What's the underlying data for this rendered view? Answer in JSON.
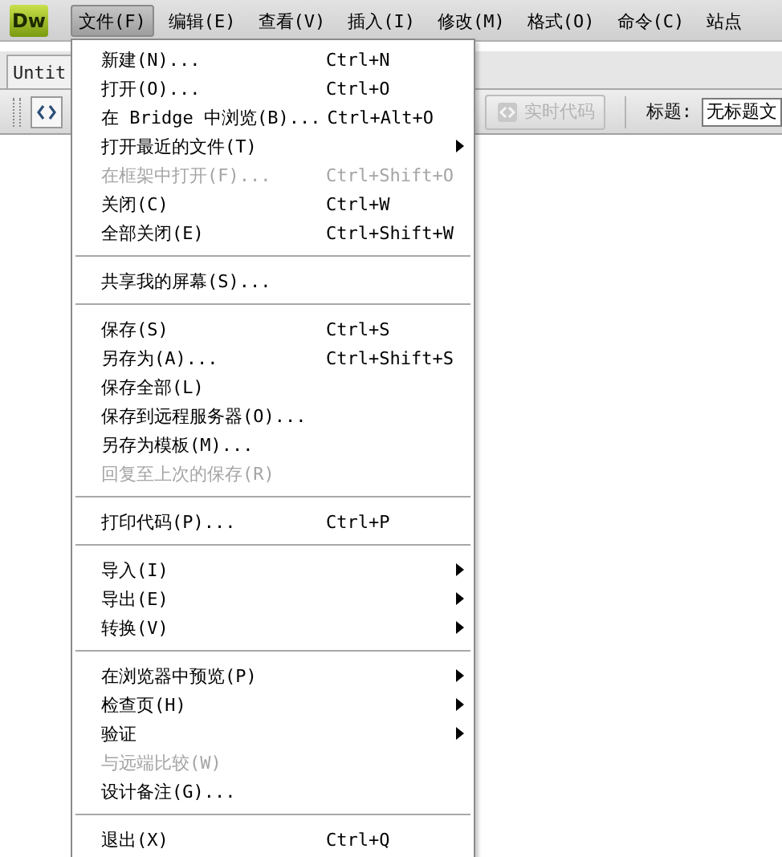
{
  "app": {
    "logo": "Dw"
  },
  "menubar": [
    {
      "label": "文件(F)",
      "selected": true
    },
    {
      "label": "编辑(E)",
      "selected": false
    },
    {
      "label": "查看(V)",
      "selected": false
    },
    {
      "label": "插入(I)",
      "selected": false
    },
    {
      "label": "修改(M)",
      "selected": false
    },
    {
      "label": "格式(O)",
      "selected": false
    },
    {
      "label": "命令(C)",
      "selected": false
    },
    {
      "label": "站点",
      "selected": false
    }
  ],
  "document_tab": {
    "label": "Untit"
  },
  "toolbar": {
    "live_code_button": {
      "label": "实时代码",
      "disabled": true
    },
    "title_label": "标题:",
    "title_field": {
      "value": "无标题文"
    }
  },
  "menu": [
    {
      "kind": "item",
      "label": "新建(N)...",
      "shortcut": "Ctrl+N",
      "disabled": false,
      "submenu": false
    },
    {
      "kind": "item",
      "label": "打开(O)...",
      "shortcut": "Ctrl+O",
      "disabled": false,
      "submenu": false
    },
    {
      "kind": "item",
      "label": "在 Bridge 中浏览(B)...",
      "shortcut": "Ctrl+Alt+O",
      "disabled": false,
      "submenu": false
    },
    {
      "kind": "item",
      "label": "打开最近的文件(T)",
      "disabled": false,
      "submenu": true
    },
    {
      "kind": "item",
      "label": "在框架中打开(F)...",
      "shortcut": "Ctrl+Shift+O",
      "disabled": true,
      "submenu": false
    },
    {
      "kind": "item",
      "label": "关闭(C)",
      "shortcut": "Ctrl+W",
      "disabled": false,
      "submenu": false
    },
    {
      "kind": "item",
      "label": "全部关闭(E)",
      "shortcut": "Ctrl+Shift+W",
      "disabled": false,
      "submenu": false
    },
    {
      "kind": "separator"
    },
    {
      "kind": "item",
      "label": "共享我的屏幕(S)...",
      "disabled": false,
      "submenu": false
    },
    {
      "kind": "separator"
    },
    {
      "kind": "item",
      "label": "保存(S)",
      "shortcut": "Ctrl+S",
      "disabled": false,
      "submenu": false
    },
    {
      "kind": "item",
      "label": "另存为(A)...",
      "shortcut": "Ctrl+Shift+S",
      "disabled": false,
      "submenu": false
    },
    {
      "kind": "item",
      "label": "保存全部(L)",
      "disabled": false,
      "submenu": false
    },
    {
      "kind": "item",
      "label": "保存到远程服务器(O)...",
      "disabled": false,
      "submenu": false
    },
    {
      "kind": "item",
      "label": "另存为模板(M)...",
      "disabled": false,
      "submenu": false
    },
    {
      "kind": "item",
      "label": "回复至上次的保存(R)",
      "disabled": true,
      "submenu": false
    },
    {
      "kind": "separator"
    },
    {
      "kind": "item",
      "label": "打印代码(P)...",
      "shortcut": "Ctrl+P",
      "disabled": false,
      "submenu": false
    },
    {
      "kind": "separator"
    },
    {
      "kind": "item",
      "label": "导入(I)",
      "disabled": false,
      "submenu": true
    },
    {
      "kind": "item",
      "label": "导出(E)",
      "disabled": false,
      "submenu": true
    },
    {
      "kind": "item",
      "label": "转换(V)",
      "disabled": false,
      "submenu": true
    },
    {
      "kind": "separator"
    },
    {
      "kind": "item",
      "label": "在浏览器中预览(P)",
      "disabled": false,
      "submenu": true
    },
    {
      "kind": "item",
      "label": "检查页(H)",
      "disabled": false,
      "submenu": true
    },
    {
      "kind": "item",
      "label": "验证",
      "disabled": false,
      "submenu": true
    },
    {
      "kind": "item",
      "label": "与远端比较(W)",
      "disabled": true,
      "submenu": false
    },
    {
      "kind": "item",
      "label": "设计备注(G)...",
      "disabled": false,
      "submenu": false
    },
    {
      "kind": "separator"
    },
    {
      "kind": "item",
      "label": "退出(X)",
      "shortcut": "Ctrl+Q",
      "disabled": false,
      "submenu": false
    }
  ]
}
